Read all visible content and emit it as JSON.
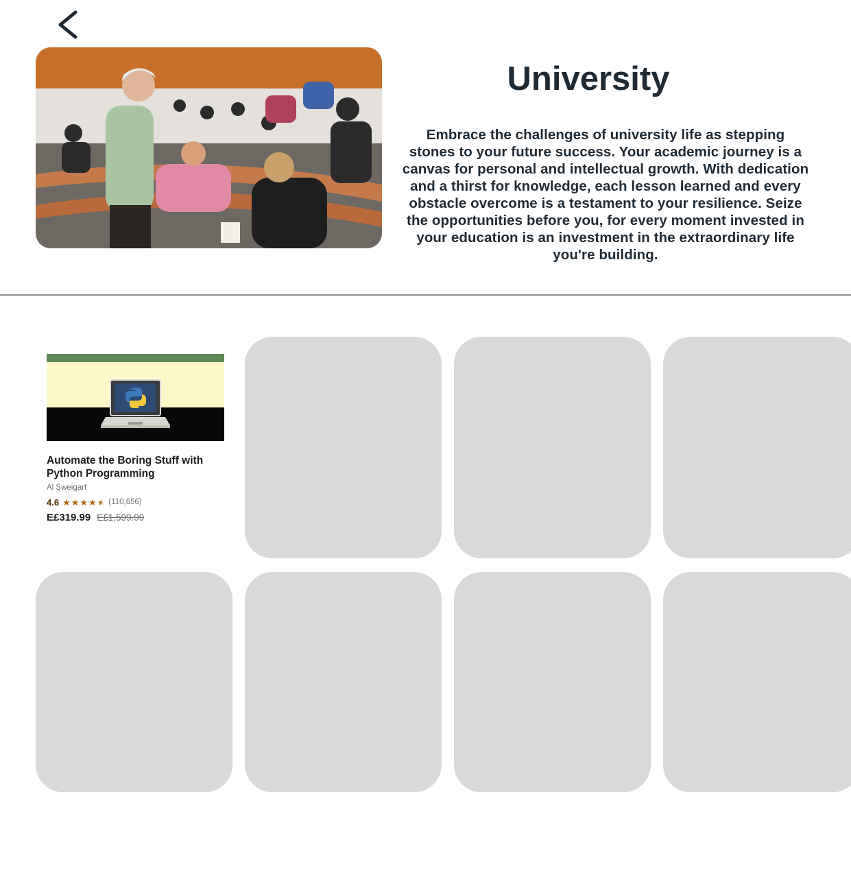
{
  "header": {
    "back_icon": "chevron-left-icon",
    "title": "University",
    "description": "Embrace the challenges of university life as stepping stones to your future success. Your academic journey is a canvas for personal and intellectual growth. With dedication and a thirst for knowledge, each lesson learned and every obstacle overcome is a testament to your resilience. Seize the opportunities before you, for every moment invested in your education is an investment in the extraordinary life you're building."
  },
  "courses": [
    {
      "title": "Automate the Boring Stuff with Python Programming",
      "author": "Al Sweigart",
      "rating": "4.6",
      "rating_fraction": 0.92,
      "rating_count": "(110,656)",
      "price": "E£319.99",
      "original_price": "E£1,599.99"
    }
  ],
  "placeholder_cards": 7,
  "colors": {
    "text_dark": "#1f2a33",
    "placeholder": "#d9d9d9",
    "divider": "#8e8e8e",
    "star": "#b4690e"
  }
}
